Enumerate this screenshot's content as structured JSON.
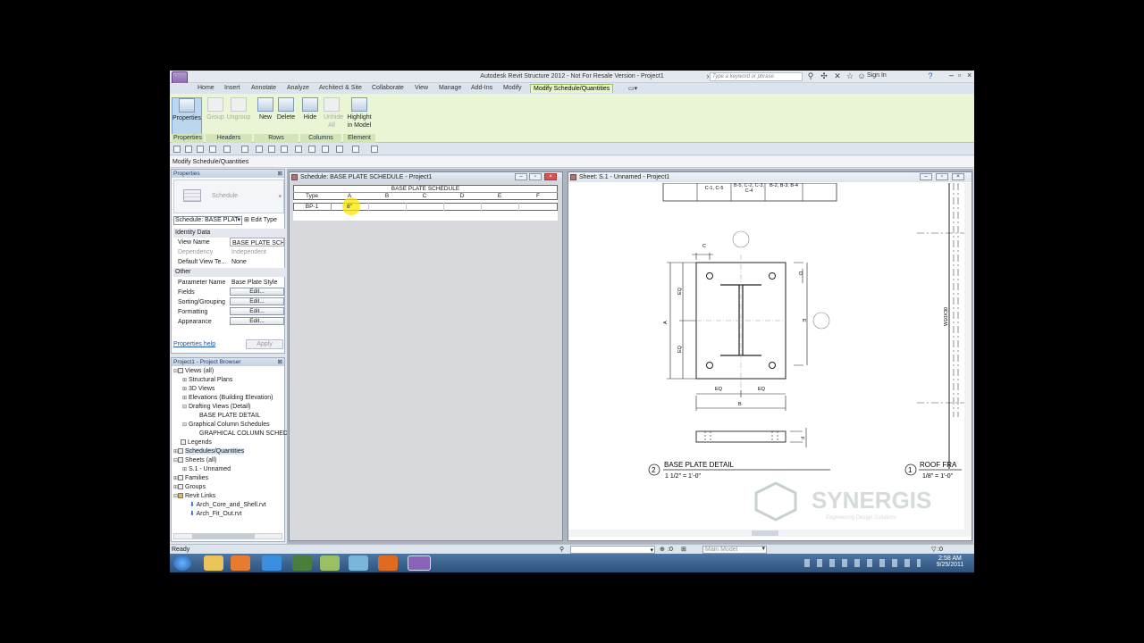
{
  "window": {
    "title": "Autodesk Revit Structure 2012 - Not For Resale Version -    Project1",
    "search_placeholder": "Type a keyword or phrase",
    "signin": "Sign In"
  },
  "tabs": [
    "Home",
    "Insert",
    "Annotate",
    "Analyze",
    "Architect & Site",
    "Collaborate",
    "View",
    "Manage",
    "Add-Ins",
    "Modify",
    "Modify Schedule/Quantities"
  ],
  "ribbon": {
    "buttons": [
      {
        "label": "Properties",
        "state": "selected"
      },
      {
        "label": "Group",
        "state": "disabled"
      },
      {
        "label": "Ungroup",
        "state": "disabled"
      },
      {
        "label": "New",
        "state": "enabled"
      },
      {
        "label": "Delete",
        "state": "enabled"
      },
      {
        "label": "Hide",
        "state": "enabled"
      },
      {
        "label": "Unhide All",
        "state": "disabled"
      },
      {
        "label": "Highlight in Model",
        "state": "enabled"
      }
    ],
    "panels": [
      "Properties",
      "Headers",
      "Rows",
      "Columns",
      "Element"
    ]
  },
  "mode_label": "Modify Schedule/Quantities",
  "properties": {
    "header": "Properties",
    "type_name": "Schedule",
    "type_selector": "Schedule: BASE PLAT",
    "edit_type": "Edit Type",
    "sections": {
      "identity": "Identity Data",
      "other": "Other"
    },
    "rows": {
      "view_name": {
        "k": "View Name",
        "v": "BASE PLATE SCHE"
      },
      "dependency": {
        "k": "Dependency",
        "v": "Independent"
      },
      "view_template": {
        "k": "Default View Te...",
        "v": "None"
      },
      "param_name": {
        "k": "Parameter Name",
        "v": "Base Plate Style"
      },
      "fields": {
        "k": "Fields",
        "v": "Edit..."
      },
      "sorting": {
        "k": "Sorting/Grouping",
        "v": "Edit..."
      },
      "formatting": {
        "k": "Formatting",
        "v": "Edit..."
      },
      "appearance": {
        "k": "Appearance",
        "v": "Edit..."
      }
    },
    "help": "Properties help",
    "apply": "Apply"
  },
  "browser": {
    "header": "Project1 - Project Browser",
    "items": [
      "Views (all)",
      "Structural Plans",
      "3D Views",
      "Elevations (Building Elevation)",
      "Drafting Views (Detail)",
      "BASE PLATE DETAIL",
      "Graphical Column Schedules",
      "GRAPHICAL COLUMN SCHEDU",
      "Legends",
      "Schedules/Quantities",
      "Sheets (all)",
      "S.1 - Unnamed",
      "Families",
      "Groups",
      "Revit Links",
      "Arch_Core_and_Shell.rvt",
      "Arch_Fit_Out.rvt"
    ]
  },
  "schedule": {
    "title": "Schedule: BASE PLATE SCHEDULE - Project1",
    "name": "BASE PLATE SCHEDULE",
    "columns": [
      "Type",
      "A",
      "B",
      "C",
      "D",
      "E",
      "F"
    ],
    "rows": [
      [
        "BP-1",
        "8\"",
        "",
        "",
        "",
        "",
        ""
      ]
    ]
  },
  "sheet": {
    "title": "Sheet: S.1 - Unnamed - Project1",
    "col_cells": [
      "C-1, C-5",
      "B-5, C-2, C-3, C-4",
      "B-2, B-3, B-4"
    ],
    "dims": [
      "C",
      "D",
      "EQ",
      "EQ",
      "A",
      "E",
      "EQ",
      "EQ",
      "B",
      "F"
    ],
    "section_label": "W10X30",
    "detail2": {
      "num": "2",
      "title": "BASE PLATE DETAIL",
      "scale": "1 1/2\" = 1'-0\""
    },
    "detail1": {
      "num": "1",
      "title": "ROOF FRA",
      "scale": "1/8\" = 1'-0\""
    },
    "logo": "SYNERGIS",
    "logo_tag": "Engineering Design Solutions"
  },
  "status": {
    "text": "Ready",
    "scale": ":0",
    "model": "Main Model",
    "filter": ":0"
  },
  "clock": {
    "time": "2:58 AM",
    "date": "9/25/2011"
  }
}
